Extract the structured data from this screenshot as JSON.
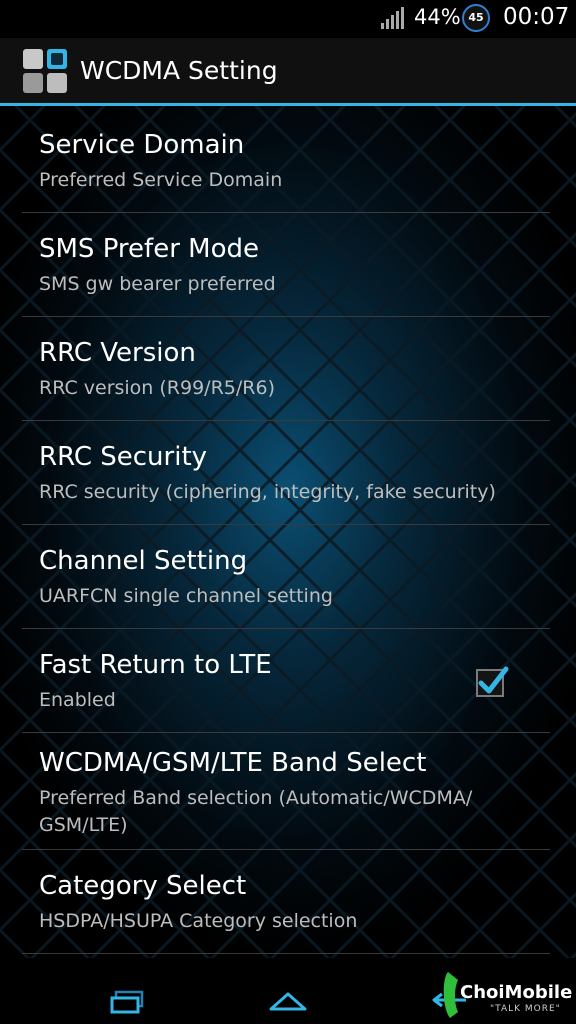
{
  "status_bar": {
    "battery_percent": "44%",
    "badge": "45",
    "clock": "00:07"
  },
  "action_bar": {
    "title": "WCDMA Setting",
    "app_icon": "grid-app-icon"
  },
  "settings": [
    {
      "title": "Service Domain",
      "summary": "Preferred Service Domain"
    },
    {
      "title": "SMS Prefer Mode",
      "summary": "SMS gw bearer preferred"
    },
    {
      "title": "RRC Version",
      "summary": "RRC version (R99/R5/R6)"
    },
    {
      "title": "RRC Security",
      "summary": "RRC security (ciphering, integrity, fake security)"
    },
    {
      "title": "Channel Setting",
      "summary": "UARFCN single channel setting"
    },
    {
      "title": "Fast Return to LTE",
      "summary": "Enabled",
      "checked": true
    },
    {
      "title": "WCDMA/GSM/LTE Band Select",
      "summary": "Preferred Band selection (Automatic/WCDMA/\nGSM/LTE)"
    },
    {
      "title": "Category Select",
      "summary": "HSDPA/HSUPA Category selection"
    }
  ],
  "nav_bar": {
    "buttons": [
      "recent-apps-icon",
      "home-icon",
      "back-icon"
    ]
  },
  "watermark": {
    "brand": "ChoiMobile",
    "tagline": "\"TALK MORE\""
  },
  "colors": {
    "accent": "#33b5e5",
    "background": "#000000",
    "summary_text": "#bdbdbd"
  }
}
